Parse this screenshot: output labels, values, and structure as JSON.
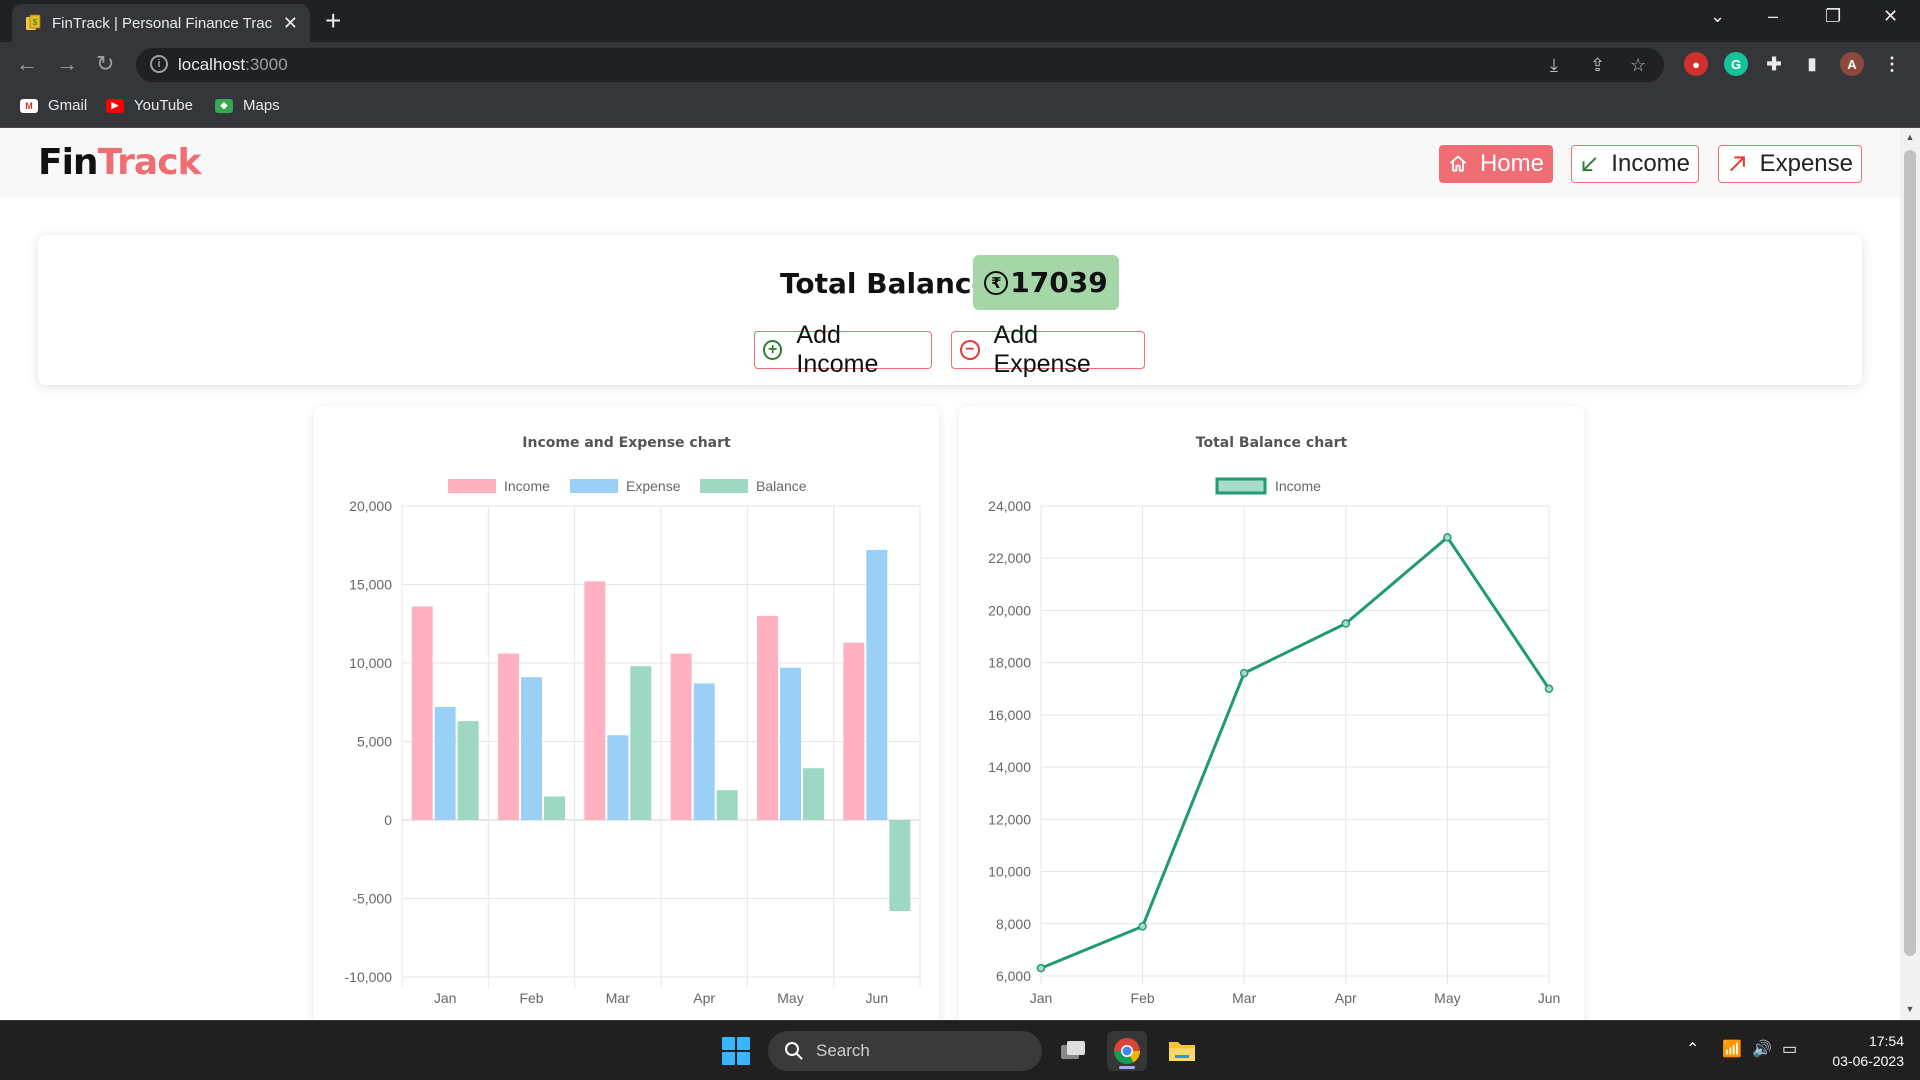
{
  "browser": {
    "tab_title": "FinTrack | Personal Finance Tracki",
    "url_host": "localhost",
    "url_port": ":3000",
    "bookmarks": [
      "Gmail",
      "YouTube",
      "Maps"
    ],
    "profile_initial": "A"
  },
  "app": {
    "logo_part1": "Fin",
    "logo_part2": "Track",
    "nav": [
      "Home",
      "Income",
      "Expense"
    ],
    "balance_label": "Total Balance",
    "currency_symbol": "₹",
    "balance_value": "17039",
    "add_income_label": "Add Income",
    "add_expense_label": "Add Expense"
  },
  "colors": {
    "accent": "#ee6e73",
    "balance_bg": "#a5d6a7",
    "income_bar": "#ffb1c1",
    "expense_bar": "#9ad0f5",
    "balance_bar": "#9fd8c2",
    "line": "#1f9a73"
  },
  "chart_data": [
    {
      "type": "bar",
      "title": "Income and Expense chart",
      "categories": [
        "Jan",
        "Feb",
        "Mar",
        "Apr",
        "May",
        "Jun"
      ],
      "series": [
        {
          "name": "Income",
          "values": [
            13600,
            10600,
            15200,
            10600,
            13000,
            11300
          ]
        },
        {
          "name": "Expense",
          "values": [
            7200,
            9100,
            5400,
            8700,
            9700,
            17200
          ]
        },
        {
          "name": "Balance",
          "values": [
            6300,
            1500,
            9800,
            1900,
            3300,
            -5800
          ]
        }
      ],
      "ylim": [
        -10000,
        20000
      ],
      "yticks": [
        "20,000",
        "15,000",
        "10,000",
        "5,000",
        "0",
        "-5,000",
        "-10,000"
      ],
      "legend": "top",
      "grid": true
    },
    {
      "type": "line",
      "title": "Total Balance chart",
      "categories": [
        "Jan",
        "Feb",
        "Mar",
        "Apr",
        "May",
        "Jun"
      ],
      "series": [
        {
          "name": "Income",
          "values": [
            6300,
            7900,
            17600,
            19500,
            22800,
            17000
          ]
        }
      ],
      "ylim": [
        6000,
        24000
      ],
      "yticks": [
        "24,000",
        "22,000",
        "20,000",
        "18,000",
        "16,000",
        "14,000",
        "12,000",
        "10,000",
        "8,000",
        "6,000"
      ],
      "legend": "top",
      "grid": true
    }
  ],
  "taskbar": {
    "search_label": "Search",
    "time": "17:54",
    "date": "03-06-2023"
  }
}
